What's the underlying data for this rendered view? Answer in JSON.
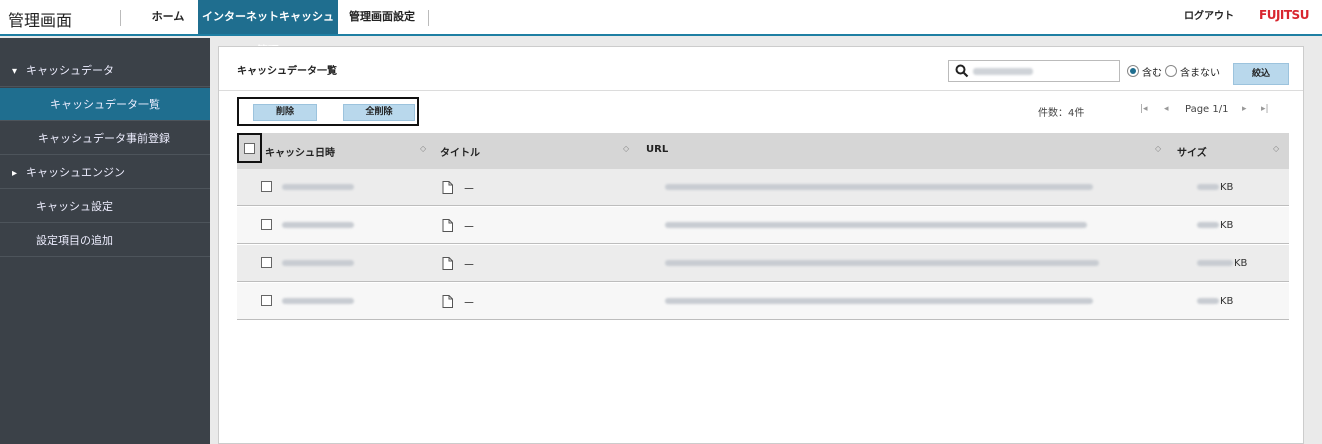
{
  "header": {
    "app_title": "管理画面",
    "nav": [
      {
        "label": "ホーム"
      },
      {
        "label": "インターネットキャッシュ管理"
      },
      {
        "label": "管理画面設定"
      }
    ],
    "logout": "ログアウト",
    "logo": "FUJITSU"
  },
  "sidebar": {
    "items": [
      {
        "label": "キャッシュデータ",
        "expand": "▾"
      },
      {
        "label": "キャッシュデータ一覧"
      },
      {
        "label": "キャッシュデータ事前登録"
      },
      {
        "label": "キャッシュエンジン",
        "expand": "▸"
      },
      {
        "label": "キャッシュ設定"
      },
      {
        "label": "設定項目の追加"
      }
    ]
  },
  "panel": {
    "title": "キャッシュデータ一覧",
    "search_value": "",
    "radio_include": "含む",
    "radio_exclude": "含まない",
    "filter_label": "絞込",
    "delete_label": "削除",
    "delete_all_label": "全削除",
    "count": "件数：4件",
    "page": "Page 1/1",
    "pager_first": "|◂",
    "pager_prev": "◂",
    "pager_next": "▸",
    "pager_last": "▸|"
  },
  "table": {
    "columns": [
      "キャッシュ日時",
      "タイトル",
      "URL",
      "サイズ"
    ],
    "sort_icon": "◇",
    "rows": [
      {
        "title": "－",
        "size_unit": "KB"
      },
      {
        "title": "－",
        "size_unit": "KB"
      },
      {
        "title": "－",
        "size_unit": "KB"
      },
      {
        "title": "－",
        "size_unit": "KB"
      }
    ]
  },
  "colors": {
    "accent": "#1f6e8f",
    "sidebar_bg": "#3b4148",
    "button_bg": "#b9d8ec",
    "logo_red": "#d8262f"
  }
}
